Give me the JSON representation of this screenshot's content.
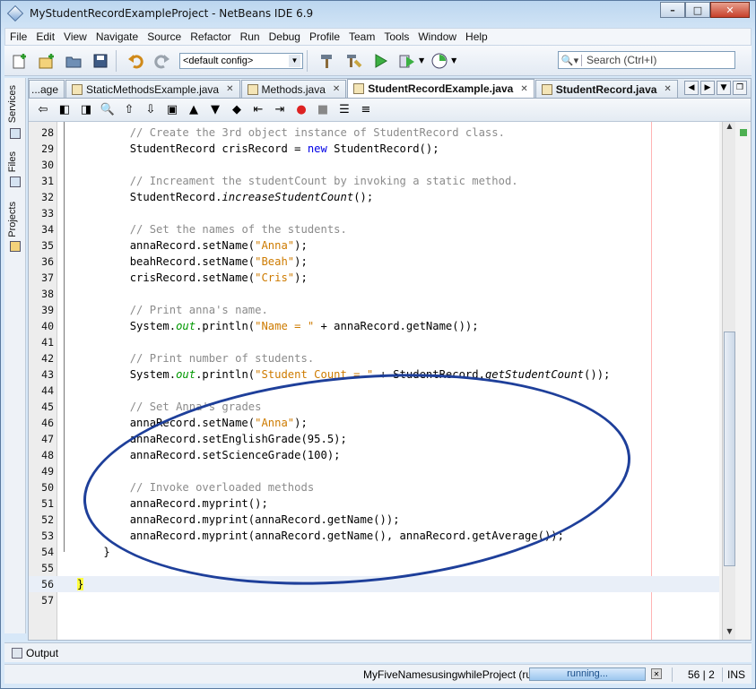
{
  "window": {
    "title": "MyStudentRecordExampleProject - NetBeans IDE 6.9",
    "minimize": "–",
    "maximize": "□",
    "close": "✕"
  },
  "menu": [
    "File",
    "Edit",
    "View",
    "Navigate",
    "Source",
    "Refactor",
    "Run",
    "Debug",
    "Profile",
    "Team",
    "Tools",
    "Window",
    "Help"
  ],
  "toolbar": {
    "config": "<default config>",
    "search_placeholder": "Search (Ctrl+I)"
  },
  "side_tabs": {
    "services": "Services",
    "files": "Files",
    "projects": "Projects"
  },
  "tabs": [
    {
      "label": "...age",
      "active": false
    },
    {
      "label": "StaticMethodsExample.java",
      "active": false
    },
    {
      "label": "Methods.java",
      "active": false
    },
    {
      "label": "StudentRecordExample.java",
      "active": true
    },
    {
      "label": "StudentRecord.java",
      "active": false
    }
  ],
  "code_lines": [
    {
      "n": 28,
      "segs": [
        [
          "        ",
          ""
        ],
        [
          "// Create the 3rd object instance of StudentRecord class.",
          "cm"
        ]
      ]
    },
    {
      "n": 29,
      "segs": [
        [
          "        StudentRecord crisRecord = ",
          ""
        ],
        [
          "new",
          "kw"
        ],
        [
          " StudentRecord();",
          ""
        ]
      ]
    },
    {
      "n": 30,
      "segs": []
    },
    {
      "n": 31,
      "segs": [
        [
          "        ",
          ""
        ],
        [
          "// Increament the studentCount by invoking a static method.",
          "cm"
        ]
      ]
    },
    {
      "n": 32,
      "segs": [
        [
          "        StudentRecord.",
          ""
        ],
        [
          "increaseStudentCount",
          "it"
        ],
        [
          "();",
          ""
        ]
      ]
    },
    {
      "n": 33,
      "segs": []
    },
    {
      "n": 34,
      "segs": [
        [
          "        ",
          ""
        ],
        [
          "// Set the names of the students.",
          "cm"
        ]
      ]
    },
    {
      "n": 35,
      "segs": [
        [
          "        annaRecord.setName(",
          ""
        ],
        [
          "\"Anna\"",
          "str"
        ],
        [
          ");",
          ""
        ]
      ]
    },
    {
      "n": 36,
      "segs": [
        [
          "        beahRecord.setName(",
          ""
        ],
        [
          "\"Beah\"",
          "str"
        ],
        [
          ");",
          ""
        ]
      ]
    },
    {
      "n": 37,
      "segs": [
        [
          "        crisRecord.setName(",
          ""
        ],
        [
          "\"Cris\"",
          "str"
        ],
        [
          ");",
          ""
        ]
      ]
    },
    {
      "n": 38,
      "segs": []
    },
    {
      "n": 39,
      "segs": [
        [
          "        ",
          ""
        ],
        [
          "// Print anna's name.",
          "cm"
        ]
      ]
    },
    {
      "n": 40,
      "segs": [
        [
          "        System.",
          ""
        ],
        [
          "out",
          "fld"
        ],
        [
          ".println(",
          ""
        ],
        [
          "\"Name = \"",
          "str"
        ],
        [
          " + annaRecord.getName());",
          ""
        ]
      ]
    },
    {
      "n": 41,
      "segs": []
    },
    {
      "n": 42,
      "segs": [
        [
          "        ",
          ""
        ],
        [
          "// Print number of students.",
          "cm"
        ]
      ]
    },
    {
      "n": 43,
      "segs": [
        [
          "        System.",
          ""
        ],
        [
          "out",
          "fld"
        ],
        [
          ".println(",
          ""
        ],
        [
          "\"Student Count = \"",
          "str"
        ],
        [
          " + StudentRecord.",
          ""
        ],
        [
          "getStudentCount",
          "it"
        ],
        [
          "());",
          ""
        ]
      ]
    },
    {
      "n": 44,
      "segs": []
    },
    {
      "n": 45,
      "segs": [
        [
          "        ",
          ""
        ],
        [
          "// Set Anna's grades",
          "cm"
        ]
      ]
    },
    {
      "n": 46,
      "segs": [
        [
          "        annaRecord.setName(",
          ""
        ],
        [
          "\"Anna\"",
          "str"
        ],
        [
          ");",
          ""
        ]
      ]
    },
    {
      "n": 47,
      "segs": [
        [
          "        annaRecord.setEnglishGrade(95.5);",
          ""
        ]
      ]
    },
    {
      "n": 48,
      "segs": [
        [
          "        annaRecord.setScienceGrade(100);",
          ""
        ]
      ]
    },
    {
      "n": 49,
      "segs": []
    },
    {
      "n": 50,
      "segs": [
        [
          "        ",
          ""
        ],
        [
          "// Invoke overloaded methods",
          "cm"
        ]
      ]
    },
    {
      "n": 51,
      "segs": [
        [
          "        annaRecord.myprint();",
          ""
        ]
      ]
    },
    {
      "n": 52,
      "segs": [
        [
          "        annaRecord.myprint(annaRecord.getName());",
          ""
        ]
      ]
    },
    {
      "n": 53,
      "segs": [
        [
          "        annaRecord.myprint(annaRecord.getName(), annaRecord.getAverage());",
          ""
        ]
      ]
    },
    {
      "n": 54,
      "segs": [
        [
          "    }",
          ""
        ]
      ]
    },
    {
      "n": 55,
      "segs": []
    },
    {
      "n": 56,
      "segs": [
        [
          "}",
          "brace"
        ]
      ],
      "current": true
    },
    {
      "n": 57,
      "segs": []
    }
  ],
  "output": {
    "label": "Output"
  },
  "status": {
    "project": "MyFiveNamesusingwhileProject (run)",
    "progress_text": "running...",
    "progress": 1.0,
    "position": "56 | 2",
    "mode": "INS"
  }
}
